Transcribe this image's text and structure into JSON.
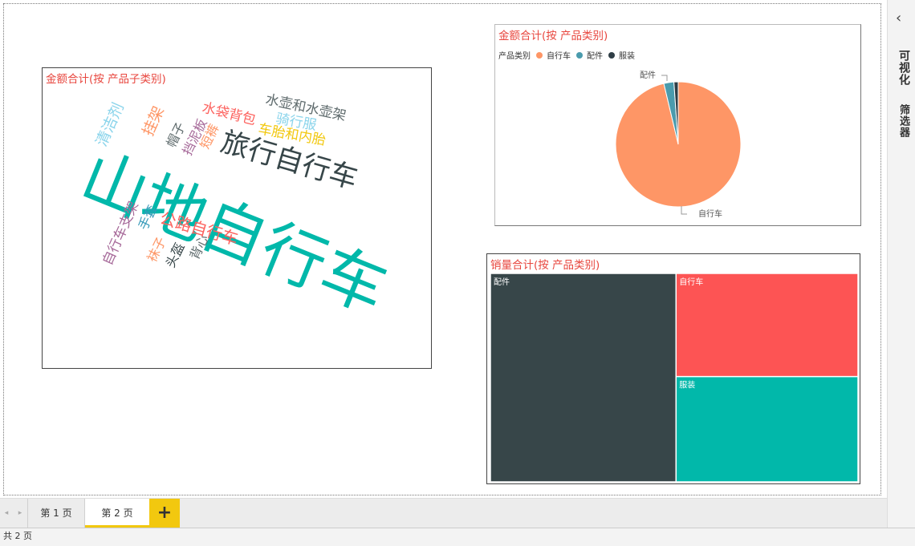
{
  "canvas": {
    "wordcloud": {
      "title": "金额合计(按 产品子类别)",
      "words": [
        {
          "text": "山地自行车",
          "color": "#01b8aa"
        },
        {
          "text": "旅行自行车",
          "color": "#374649"
        },
        {
          "text": "公路自行车",
          "color": "#fd625e"
        },
        {
          "text": "水壶和水壶架",
          "color": "#5f6b6d"
        },
        {
          "text": "骑行服",
          "color": "#8ad4eb"
        },
        {
          "text": "车胎和内胎",
          "color": "#f2c80f"
        },
        {
          "text": "水袋背包",
          "color": "#fd625e"
        },
        {
          "text": "清洁剂",
          "color": "#8ad4eb"
        },
        {
          "text": "挂架",
          "color": "#fe9666"
        },
        {
          "text": "帽子",
          "color": "#5f6b6d"
        },
        {
          "text": "挡泥板",
          "color": "#a66999"
        },
        {
          "text": "短裤",
          "color": "#fe9666"
        },
        {
          "text": "自行车支架",
          "color": "#a66999"
        },
        {
          "text": "手套",
          "color": "#3599b8"
        },
        {
          "text": "袜子",
          "color": "#fe9666"
        },
        {
          "text": "头盔",
          "color": "#374649"
        },
        {
          "text": "背心",
          "color": "#5f6b6d"
        }
      ]
    },
    "pie": {
      "title": "金额合计(按 产品类别)",
      "legend_title": "产品类别",
      "legend": [
        {
          "label": "自行车",
          "color": "#fe9666"
        },
        {
          "label": "配件",
          "color": "#4a9bad"
        },
        {
          "label": "服装",
          "color": "#2f3e46"
        }
      ],
      "callouts": {
        "top": "配件",
        "bottom": "自行车"
      }
    },
    "treemap": {
      "title": "销量合计(按 产品类别)",
      "cells": [
        {
          "label": "配件",
          "color": "#374649"
        },
        {
          "label": "自行车",
          "color": "#fd5454"
        },
        {
          "label": "服装",
          "color": "#01b8aa"
        }
      ]
    }
  },
  "right_pane": {
    "collapse_glyph": "‹",
    "visualization": "可视化",
    "filters": "筛选器"
  },
  "tabs": {
    "prev": "◂",
    "next": "▸",
    "page1": "第 1 页",
    "page2": "第 2 页",
    "add": "+"
  },
  "status": {
    "text": "共 2 页"
  },
  "chart_data": [
    {
      "type": "pie",
      "title": "金额合计(按 产品类别)",
      "legend_title": "产品类别",
      "categories": [
        "自行车",
        "配件",
        "服装"
      ],
      "values": [
        96.3,
        2.6,
        1.1
      ]
    },
    {
      "type": "treemap",
      "title": "销量合计(按 产品类别)",
      "categories": [
        "配件",
        "自行车",
        "服装"
      ],
      "values": [
        50.5,
        24.5,
        25.0
      ]
    }
  ]
}
